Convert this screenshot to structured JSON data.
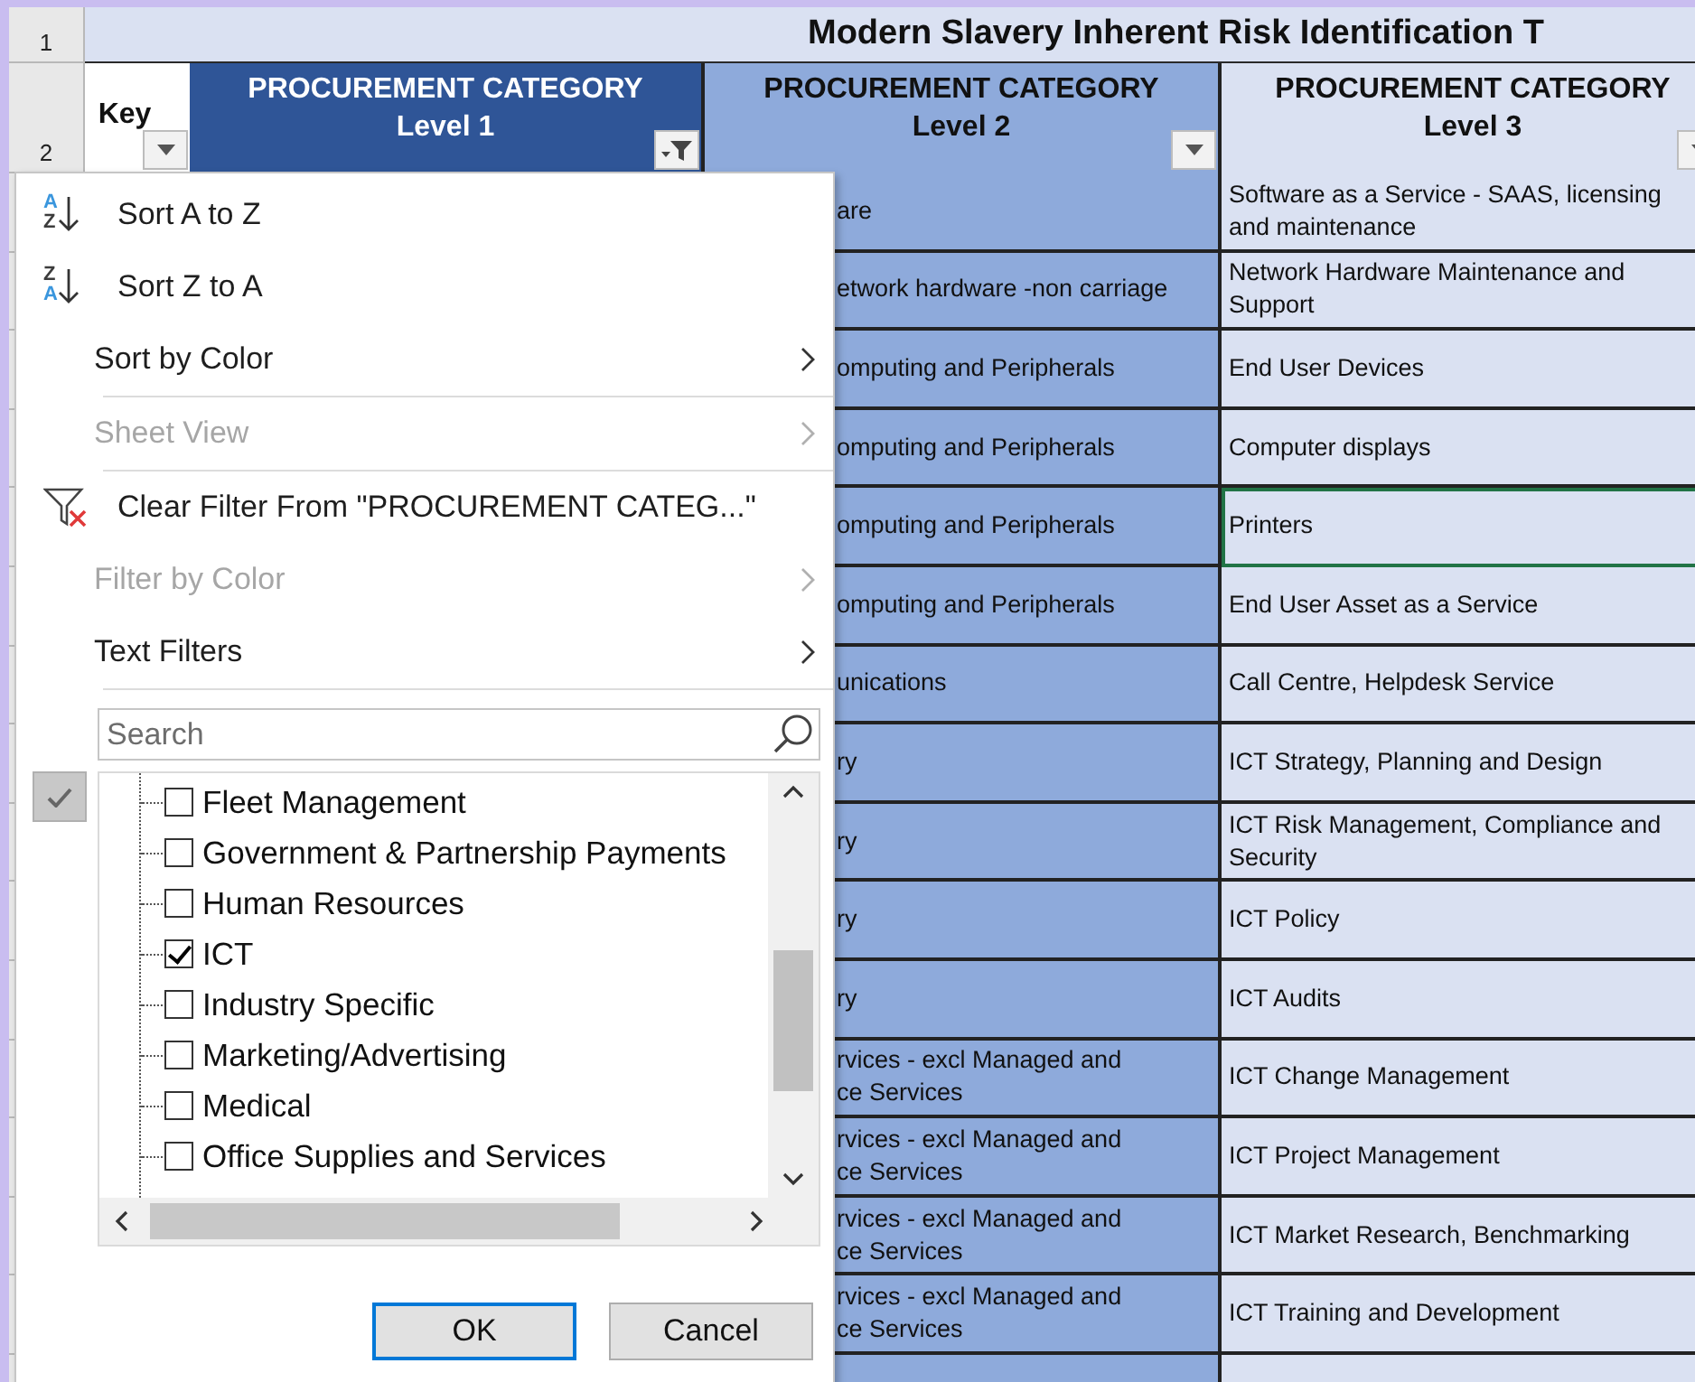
{
  "sheet": {
    "title": "Modern Slavery Inherent Risk Identification T",
    "row_numbers": [
      "1",
      "2"
    ],
    "headers": [
      {
        "kind": "key",
        "label": "Key",
        "filtered": false
      },
      {
        "kind": "level1",
        "title": "PROCUREMENT CATEGORY",
        "level_label": "Level 1",
        "filtered": true
      },
      {
        "kind": "level2",
        "title": "PROCUREMENT CATEGORY",
        "level_label": "Level 2",
        "filtered": false
      },
      {
        "kind": "level3",
        "title": "PROCUREMENT CATEGORY",
        "level_label": "Level 3",
        "filtered": false
      }
    ],
    "rows": [
      {
        "level_2": "are",
        "level_3": "Software as a Service - SAAS, licensing\nand maintenance",
        "selected": false
      },
      {
        "level_2": "etwork hardware -non carriage",
        "level_3": "Network Hardware Maintenance and\nSupport",
        "selected": false
      },
      {
        "level_2": "omputing and Peripherals",
        "level_3": "End User Devices",
        "selected": false
      },
      {
        "level_2": "omputing and Peripherals",
        "level_3": "Computer displays",
        "selected": false
      },
      {
        "level_2": "omputing and Peripherals",
        "level_3": "Printers",
        "selected": true
      },
      {
        "level_2": "omputing and Peripherals",
        "level_3": "End User Asset as a Service",
        "selected": false
      },
      {
        "level_2": "unications",
        "level_3": "Call Centre, Helpdesk Service",
        "selected": false
      },
      {
        "level_2": "ry",
        "level_3": "ICT Strategy, Planning and Design",
        "selected": false
      },
      {
        "level_2": "ry",
        "level_3": "ICT Risk Management, Compliance and\nSecurity",
        "selected": false
      },
      {
        "level_2": "ry",
        "level_3": "ICT Policy",
        "selected": false
      },
      {
        "level_2": "ry",
        "level_3": "ICT Audits",
        "selected": false
      },
      {
        "level_2": "rvices - excl Managed and\nce Services",
        "level_3": "ICT Change Management",
        "selected": false
      },
      {
        "level_2": "rvices - excl Managed and\nce Services",
        "level_3": "ICT Project Management",
        "selected": false
      },
      {
        "level_2": "rvices - excl Managed and\nce Services",
        "level_3": "ICT Market Research, Benchmarking",
        "selected": false
      },
      {
        "level_2": "rvices - excl Managed and\nce Services",
        "level_3": "ICT Training and Development",
        "selected": false
      }
    ]
  },
  "filter_menu": {
    "items": [
      {
        "kind": "sort_asc",
        "label": "Sort A to Z",
        "icon_letters": [
          {
            "text": "A",
            "color": "#3a96dd"
          },
          {
            "text": "Z",
            "color": "#3c3c3c"
          }
        ],
        "disabled": false,
        "submenu": false,
        "separator_after": false
      },
      {
        "kind": "sort_desc",
        "label": "Sort Z to A",
        "icon_letters": [
          {
            "text": "Z",
            "color": "#3c3c3c"
          },
          {
            "text": "A",
            "color": "#3a96dd"
          }
        ],
        "disabled": false,
        "submenu": false,
        "separator_after": false
      },
      {
        "kind": "plain",
        "label": "Sort by Color",
        "disabled": false,
        "submenu": true,
        "separator_after": true
      },
      {
        "kind": "plain",
        "label": "Sheet View",
        "disabled": true,
        "submenu": true,
        "separator_after": true
      },
      {
        "kind": "clear_filter",
        "label": "Clear Filter From \"PROCUREMENT CATEG...\"",
        "disabled": false,
        "submenu": false,
        "separator_after": false
      },
      {
        "kind": "plain",
        "label": "Filter by Color",
        "disabled": true,
        "submenu": true,
        "separator_after": false
      },
      {
        "kind": "plain",
        "label": "Text Filters",
        "disabled": false,
        "submenu": true,
        "separator_after": true
      }
    ],
    "search": {
      "placeholder": "Search"
    },
    "values": [
      {
        "label": "Fleet Management",
        "checked": false
      },
      {
        "label": "Government & Partnership Payments",
        "checked": false
      },
      {
        "label": "Human Resources",
        "checked": false
      },
      {
        "label": "ICT",
        "checked": true
      },
      {
        "label": "Industry Specific",
        "checked": false
      },
      {
        "label": "Marketing/Advertising",
        "checked": false
      },
      {
        "label": "Medical",
        "checked": false
      },
      {
        "label": "Office Supplies and Services",
        "checked": false
      }
    ],
    "buttons": [
      {
        "label": "OK",
        "default": true
      },
      {
        "label": "Cancel",
        "default": false
      }
    ]
  }
}
